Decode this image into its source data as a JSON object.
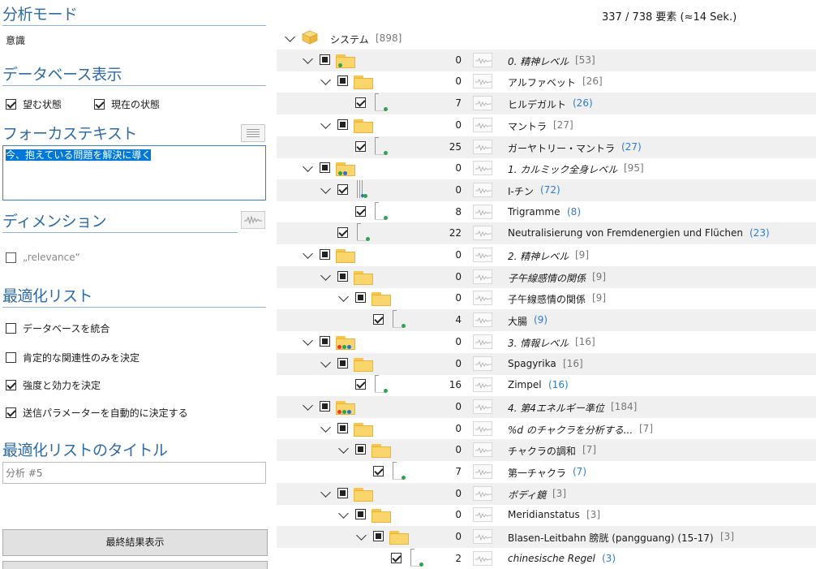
{
  "left": {
    "analysis_mode_header": "分析モード",
    "analysis_mode_value": "意識",
    "db_display_header": "データベース表示",
    "db_checks": [
      {
        "label": "望む状態",
        "checked": true
      },
      {
        "label": "現在の状態",
        "checked": true
      }
    ],
    "focus_header": "フォーカステキスト",
    "focus_text": "今、抱えている問題を解決に導く",
    "dimension_header": "ディメンション",
    "dimension_check": {
      "label": "„relevance“",
      "checked": false
    },
    "optimization_header": "最適化リスト",
    "optimization_checks": [
      {
        "label": "データベースを統合",
        "checked": false
      },
      {
        "label": "肯定的な関連性のみを決定",
        "checked": false
      },
      {
        "label": "強度と効力を決定",
        "checked": true
      },
      {
        "label": "送信パラメーターを自動的に決定する",
        "checked": true
      }
    ],
    "title_header": "最適化リストのタイトル",
    "title_value": "分析 #5",
    "final_button": "最終結果表示"
  },
  "count_text": "337 / 738 要素 (≈14 Sek.)",
  "colors": {
    "accent": "#2f6aa3",
    "selection": "#0078d7",
    "count_blue": "#2f7bd1"
  },
  "tree": {
    "rows": [
      {
        "name": "システム",
        "count": "[898]",
        "num": "",
        "italic": false,
        "count_style": "grey",
        "depth": 0,
        "chev": true,
        "box": "none",
        "icon": "system"
      },
      {
        "name": "0. 精神レベル",
        "count": "[53]",
        "num": "0",
        "italic": true,
        "count_style": "grey",
        "depth": 1,
        "chev": true,
        "box": "mixed",
        "icon": "folder-g"
      },
      {
        "name": "アルファベット",
        "count": "[26]",
        "num": "0",
        "italic": false,
        "count_style": "grey",
        "depth": 2,
        "chev": true,
        "box": "mixed",
        "icon": "folder"
      },
      {
        "name": "ヒルデガルト",
        "count": "(26)",
        "num": "7",
        "italic": false,
        "count_style": "blue",
        "depth": 3,
        "chev": false,
        "box": "on",
        "icon": "doc"
      },
      {
        "name": "マントラ",
        "count": "[27]",
        "num": "0",
        "italic": false,
        "count_style": "grey",
        "depth": 2,
        "chev": true,
        "box": "mixed",
        "icon": "folder"
      },
      {
        "name": "ガーヤトリー・マントラ",
        "count": "(27)",
        "num": "25",
        "italic": false,
        "count_style": "blue",
        "depth": 3,
        "chev": false,
        "box": "on",
        "icon": "doc"
      },
      {
        "name": "1. カルミック全身レベル",
        "count": "[95]",
        "num": "0",
        "italic": true,
        "count_style": "grey",
        "depth": 1,
        "chev": true,
        "box": "mixed",
        "icon": "folder-gb"
      },
      {
        "name": "I-チン",
        "count": "(72)",
        "num": "0",
        "italic": false,
        "count_style": "blue",
        "depth": 2,
        "chev": true,
        "box": "on",
        "icon": "doc-stack"
      },
      {
        "name": "Trigramme",
        "count": "(8)",
        "num": "8",
        "italic": false,
        "count_style": "blue",
        "depth": 3,
        "chev": false,
        "box": "on",
        "icon": "doc"
      },
      {
        "name": "Neutralisierung von Fremdenergien und Flüchen",
        "count": "(23)",
        "num": "22",
        "italic": false,
        "count_style": "blue",
        "depth": 2,
        "chev": false,
        "box": "on",
        "icon": "doc"
      },
      {
        "name": "2. 精神レベル",
        "count": "[9]",
        "num": "0",
        "italic": true,
        "count_style": "grey",
        "depth": 1,
        "chev": true,
        "box": "mixed",
        "icon": "folder"
      },
      {
        "name": "子午線感情の関係",
        "count": "[9]",
        "num": "0",
        "italic": true,
        "count_style": "grey",
        "depth": 2,
        "chev": true,
        "box": "mixed",
        "icon": "folder"
      },
      {
        "name": "子午線感情の関係",
        "count": "[9]",
        "num": "0",
        "italic": false,
        "count_style": "grey",
        "depth": 3,
        "chev": true,
        "box": "mixed",
        "icon": "folder"
      },
      {
        "name": "大腸",
        "count": "(9)",
        "num": "4",
        "italic": false,
        "count_style": "blue",
        "depth": 4,
        "chev": false,
        "box": "on",
        "icon": "doc"
      },
      {
        "name": "3. 情報レベル",
        "count": "[16]",
        "num": "0",
        "italic": true,
        "count_style": "grey",
        "depth": 1,
        "chev": true,
        "box": "mixed",
        "icon": "folder-rgb"
      },
      {
        "name": "Spagyrika",
        "count": "[16]",
        "num": "0",
        "italic": false,
        "count_style": "grey",
        "depth": 2,
        "chev": true,
        "box": "mixed",
        "icon": "folder"
      },
      {
        "name": "Zimpel",
        "count": "(16)",
        "num": "16",
        "italic": false,
        "count_style": "blue",
        "depth": 3,
        "chev": false,
        "box": "on",
        "icon": "doc"
      },
      {
        "name": "4. 第4エネルギー準位",
        "count": "[184]",
        "num": "0",
        "italic": true,
        "count_style": "grey",
        "depth": 1,
        "chev": true,
        "box": "mixed",
        "icon": "folder-rgb"
      },
      {
        "name": "%d のチャクラを分析する...",
        "count": "[7]",
        "num": "0",
        "italic": true,
        "count_style": "grey",
        "depth": 2,
        "chev": true,
        "box": "mixed",
        "icon": "folder"
      },
      {
        "name": "チャクラの調和",
        "count": "[7]",
        "num": "0",
        "italic": false,
        "count_style": "grey",
        "depth": 3,
        "chev": true,
        "box": "mixed",
        "icon": "folder"
      },
      {
        "name": "第一チャクラ",
        "count": "(7)",
        "num": "7",
        "italic": false,
        "count_style": "blue",
        "depth": 4,
        "chev": false,
        "box": "on",
        "icon": "doc"
      },
      {
        "name": "ボディ鏡",
        "count": "[3]",
        "num": "0",
        "italic": true,
        "count_style": "grey",
        "depth": 2,
        "chev": true,
        "box": "mixed",
        "icon": "folder"
      },
      {
        "name": "Meridianstatus",
        "count": "[3]",
        "num": "0",
        "italic": false,
        "count_style": "grey",
        "depth": 3,
        "chev": true,
        "box": "mixed",
        "icon": "folder"
      },
      {
        "name": "Blasen-Leitbahn 膀胱 (pangguang) (15-17)",
        "count": "[3]",
        "num": "0",
        "italic": false,
        "count_style": "grey",
        "depth": 4,
        "chev": true,
        "box": "mixed",
        "icon": "folder"
      },
      {
        "name": "chinesische Regel",
        "count": "(3)",
        "num": "2",
        "italic": true,
        "count_style": "blue",
        "depth": 5,
        "chev": false,
        "box": "on",
        "icon": "doc"
      }
    ]
  }
}
